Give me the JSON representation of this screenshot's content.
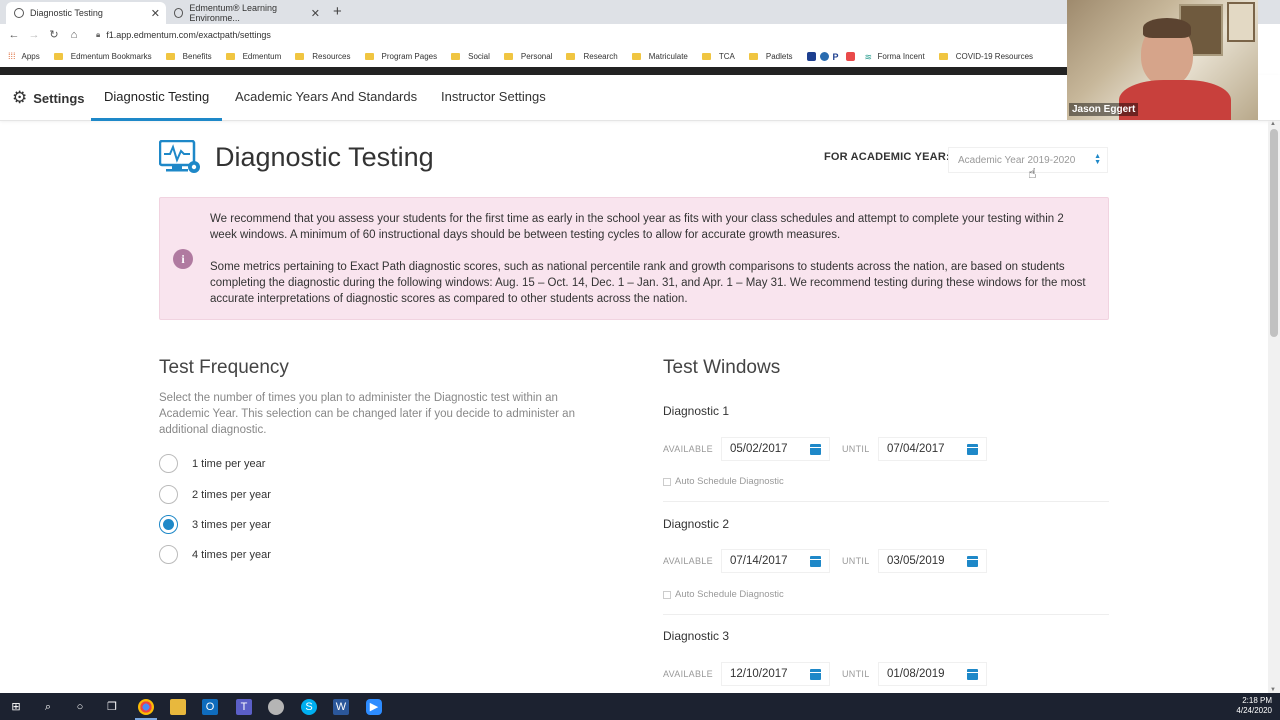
{
  "browser": {
    "tabs": [
      {
        "label": "Diagnostic Testing",
        "active": true
      },
      {
        "label": "Edmentum® Learning Environme...",
        "active": false
      }
    ],
    "url": "f1.app.edmentum.com/exactpath/settings",
    "bookmarks": [
      "Apps",
      "Edmentum Bookmarks",
      "Benefits",
      "Edmentum",
      "Resources",
      "Program Pages",
      "Social",
      "Personal",
      "Research",
      "Matriculate",
      "TCA",
      "Padlets",
      "Forma Incent",
      "COVID-19 Resources"
    ]
  },
  "webcam": {
    "name": "Jason Eggert"
  },
  "header": {
    "settings_label": "Settings",
    "tabs": [
      "Diagnostic Testing",
      "Academic Years And Standards",
      "Instructor Settings"
    ]
  },
  "main": {
    "title": "Diagnostic Testing",
    "year_label": "FOR ACADEMIC YEAR:",
    "year_value": "Academic Year 2019-2020",
    "alert_p1": "We recommend that you assess your students for the first time as early in the school year as fits with your class schedules and attempt to complete your testing within 2 week windows. A minimum of 60 instructional days should be between testing cycles to allow for accurate growth measures.",
    "alert_p2": "Some metrics pertaining to Exact Path diagnostic scores, such as national percentile rank and growth comparisons to students across the nation, are based on students completing the diagnostic during the following windows: Aug. 15 – Oct. 14, Dec. 1 – Jan. 31, and Apr. 1 – May 31. We recommend testing during these windows for the most accurate interpretations of diagnostic scores as compared to other students across the nation.",
    "frequency": {
      "title": "Test Frequency",
      "description": "Select the number of times you plan to administer the Diagnostic test within an Academic Year. This selection can be changed later if you decide to administer an additional diagnostic.",
      "options": [
        "1 time per year",
        "2 times per year",
        "3 times per year",
        "4 times per year"
      ],
      "selected": "3 times per year"
    },
    "windows": {
      "title": "Test Windows",
      "available_label": "AVAILABLE",
      "until_label": "UNTIL",
      "auto_label": "Auto Schedule Diagnostic",
      "items": [
        {
          "name": "Diagnostic 1",
          "available": "05/02/2017",
          "until": "07/04/2017"
        },
        {
          "name": "Diagnostic 2",
          "available": "07/14/2017",
          "until": "03/05/2019"
        },
        {
          "name": "Diagnostic 3",
          "available": "12/10/2017",
          "until": "01/08/2019"
        }
      ]
    }
  },
  "taskbar": {
    "time": "2:18 PM",
    "date": "4/24/2020"
  },
  "colors": {
    "accent": "#1e88c8",
    "alert_bg": "#f9e4ee",
    "info_icon": "#b07aa0"
  }
}
